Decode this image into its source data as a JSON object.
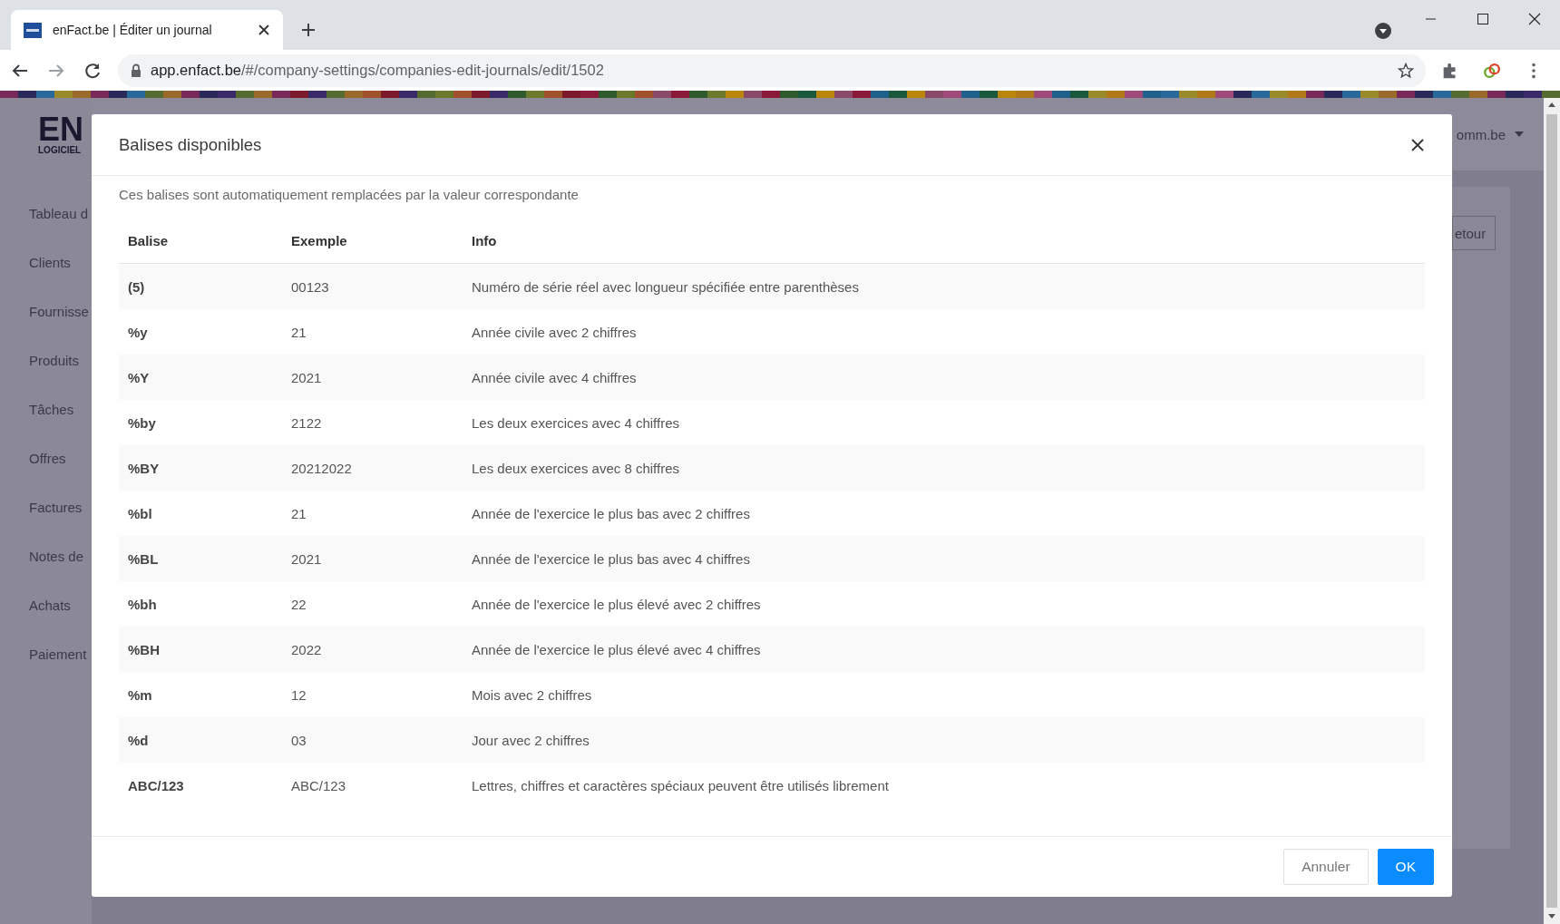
{
  "browser": {
    "tab_title": "enFact.be | Éditer un journal",
    "url_host": "app.enfact.be",
    "url_path": "/#/company-settings/companies-edit-journals/edit/1502"
  },
  "app": {
    "logo": "EN",
    "logo_sub": "LOGICIEL",
    "sidebar": [
      "Tableau d",
      "Clients",
      "Fournisse",
      "Produits",
      "Tâches",
      "Offres",
      "Factures",
      "Notes de",
      "Achats",
      "Paiement"
    ],
    "account": "omm.be",
    "back_button": "etour"
  },
  "modal": {
    "title": "Balises disponibles",
    "description": "Ces balises sont automatiquement remplacées par la valeur correspondante",
    "columns": [
      "Balise",
      "Exemple",
      "Info"
    ],
    "rows": [
      {
        "tag": "(5)",
        "example": "00123",
        "info": "Numéro de série réel avec longueur spécifiée entre parenthèses"
      },
      {
        "tag": "%y",
        "example": "21",
        "info": "Année civile avec 2 chiffres"
      },
      {
        "tag": "%Y",
        "example": "2021",
        "info": "Année civile avec 4 chiffres"
      },
      {
        "tag": "%by",
        "example": "2122",
        "info": "Les deux exercices avec 4 chiffres"
      },
      {
        "tag": "%BY",
        "example": "20212022",
        "info": "Les deux exercices avec 8 chiffres"
      },
      {
        "tag": "%bl",
        "example": "21",
        "info": "Année de l'exercice le plus bas avec 2 chiffres"
      },
      {
        "tag": "%BL",
        "example": "2021",
        "info": "Année de l'exercice le plus bas avec 4 chiffres"
      },
      {
        "tag": "%bh",
        "example": "22",
        "info": "Année de l'exercice le plus élevé avec 2 chiffres"
      },
      {
        "tag": "%BH",
        "example": "2022",
        "info": "Année de l'exercice le plus élevé avec 4 chiffres"
      },
      {
        "tag": "%m",
        "example": "12",
        "info": "Mois avec 2 chiffres"
      },
      {
        "tag": "%d",
        "example": "03",
        "info": "Jour avec 2 chiffres"
      },
      {
        "tag": "ABC/123",
        "example": "ABC/123",
        "info": "Lettres, chiffres et caractères spéciaux peuvent être utilisés librement"
      }
    ],
    "buttons": [
      {
        "label": "Annuler",
        "kind": "secondary"
      },
      {
        "label": "OK",
        "kind": "primary"
      }
    ]
  }
}
